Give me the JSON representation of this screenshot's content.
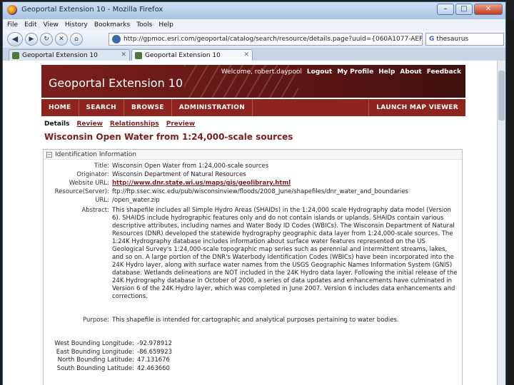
{
  "browser": {
    "window_title": "Geoportal Extension 10 - Mozilla Firefox",
    "menu": [
      "File",
      "Edit",
      "View",
      "History",
      "Bookmarks",
      "Tools",
      "Help"
    ],
    "url": "http://gpmoc.esri.com/geoportal/catalog/search/resource/details.page?uuid={060A1077-AEF",
    "search_engine": "G",
    "search_query": "thesaurus",
    "tabs": [
      {
        "label": "Geoportal Extension 10",
        "active": false
      },
      {
        "label": "Geoportal Extension 10",
        "active": true
      }
    ]
  },
  "header": {
    "brand": "Geoportal Extension 10",
    "welcome": "Welcome, robert.daypool",
    "links": [
      "Logout",
      "My Profile",
      "Help",
      "About",
      "Feedback"
    ]
  },
  "nav": {
    "items": [
      "HOME",
      "SEARCH",
      "BROWSE",
      "ADMINISTRATION"
    ],
    "launch": "LAUNCH MAP VIEWER"
  },
  "subtabs": {
    "current": "Details",
    "links": [
      "Review",
      "Relationships",
      "Preview"
    ]
  },
  "doc": {
    "title": "Wisconsin Open Water from 1:24,000-scale sources",
    "section_title": "Identification Information",
    "fields": {
      "title_label": "Title:",
      "title_value": "Wisconsin Open Water from 1:24,000-scale sources",
      "originator_label": "Originator:",
      "originator_value": "Wisconsin Department of Natural Resources",
      "website_label": "Website URL:",
      "website_value": "http://www.dnr.state.wi.us/maps/gis/geolibrary.html",
      "resource_label": "Resource(Server):",
      "resource_value": "ftp://ftp.ssec.wisc.edu/pub/wisconsinview/floods/2008_June/shapefiles/dnr_water_and_boundaries",
      "url_label": "URL:",
      "url_value": "/open_water.zip",
      "abstract_label": "Abstract:",
      "abstract_value": "This shapefile includes all Simple Hydro Areas (SHAIDs) in the 1:24,000 scale Hydrography data model (Version 6). SHAIDS include hydrographic features only and do not contain islands or uplands. SHAIDs contain various descriptive attributes, including names and Water Body ID Codes (WBICs). The Wisconsin Department of Natural Resources (DNR) developed the statewide hydrography geographic data layer from 1:24,000-scale sources. The 1:24K Hydrography database includes information about surface water features represented on the US Geological Survey's 1:24,000-scale topographic map series such as perennial and intermittent streams, lakes, and so on. A large portion of the DNR's Waterbody Identification Codes (WBICs) have been incorporated into the 24K Hydro layer, along with surface water names from the USGS Geographic Names Information System (GNIS) database. Wetlands delineations are NOT included in the 24K Hydro data layer. Following the initial release of the 24K Hydrography database in October of 2000, a series of data updates and enhancements have culminated in Version 6 of the 24K Hydro layer, which was completed in June 2007. Version 6 includes data enhancements and corrections.",
      "purpose_label": "Purpose:",
      "purpose_value": "This shapefile is intended for cartographic and analytical purposes pertaining to water bodies."
    },
    "bounds": [
      {
        "label": "West Bounding Longitude:",
        "value": "-92.978912"
      },
      {
        "label": "East Bounding Longitude:",
        "value": "-86.659923"
      },
      {
        "label": "North Bounding Latitude:",
        "value": "47.131676"
      },
      {
        "label": "South Bounding Latitude:",
        "value": "42.463660"
      }
    ]
  }
}
